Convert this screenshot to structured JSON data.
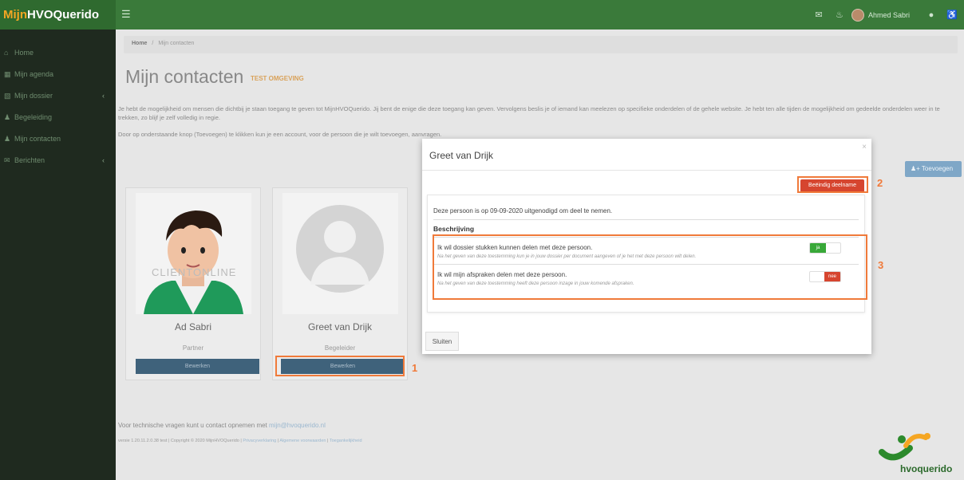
{
  "brand": {
    "part1": "Mijn",
    "part2": "HVOQuerido"
  },
  "topbar": {
    "user_name": "Ahmed Sabri"
  },
  "sidebar": {
    "items": [
      {
        "label": "Home"
      },
      {
        "label": "Mijn agenda"
      },
      {
        "label": "Mijn dossier"
      },
      {
        "label": "Begeleiding"
      },
      {
        "label": "Mijn contacten"
      },
      {
        "label": "Berichten"
      }
    ]
  },
  "breadcrumb": {
    "home": "Home",
    "separator": "/",
    "current": "Mijn contacten"
  },
  "page": {
    "title": "Mijn contacten",
    "env_badge": "TEST OMGEVING",
    "intro": "Je hebt de mogelijkheid om mensen die dichtbij je staan toegang te geven tot MijnHVOQuerido. Jij bent de enige die deze toegang kan geven. Vervolgens beslis je of iemand kan meelezen op specifieke onderdelen of de gehele website. Je hebt ten alle tijden de mogelijkheid om gedeelde onderdelen weer in te trekken, zo blijf je zelf volledig in regie.",
    "intro2": "Door op onderstaande knop (Toevoegen) te klikken kun je een account, voor de persoon die je wilt toevoegen, aanvragen.",
    "add_button": "Toevoegen"
  },
  "contacts": [
    {
      "name": "Ad Sabri",
      "role": "Partner",
      "edit_label": "Bewerken",
      "watermark": "CLIENTONLINE"
    },
    {
      "name": "Greet van Drijk",
      "role": "Begeleider",
      "edit_label": "Bewerken"
    }
  ],
  "footer": {
    "question": "Voor technische vragen kunt u contact opnemen met",
    "email": "mijn@hvoquerido.nl",
    "version": "versie 1.20.11.2.0.38 test | Copyright © 2020 MijnHVOQuerido |",
    "links": [
      "Privacyverklaring",
      "Algemene voorwaarden",
      "Toegankelijkheid"
    ],
    "logo_text": "hvoquerido"
  },
  "modal": {
    "title": "Greet van Drijk",
    "close": "×",
    "end_button": "Beëindig deelname",
    "invite_text": "Deze persoon is op 09-09-2020 uitgenodigd om deel te nemen.",
    "description_title": "Beschrijving",
    "permissions": [
      {
        "title": "Ik wil dossier stukken kunnen delen met deze persoon.",
        "subtitle": "Na het geven van deze toestemming kun je in jouw dossier per document aangeven of je het met deze persoon wilt delen.",
        "state": "ja"
      },
      {
        "title": "Ik wil mijn afspraken delen met deze persoon.",
        "subtitle": "Na het geven van deze toestemming heeft deze persoon inzage in jouw komende afspraken.",
        "state": "nee"
      }
    ],
    "close_button": "Sluiten"
  },
  "annotations": [
    "1",
    "2",
    "3"
  ],
  "colors": {
    "topbar": "#3a7a3a",
    "sidebar": "#1f2a1f",
    "accent_orange": "#f07a3a",
    "danger": "#d6452f",
    "success": "#38a838",
    "primary": "#3f627b"
  }
}
